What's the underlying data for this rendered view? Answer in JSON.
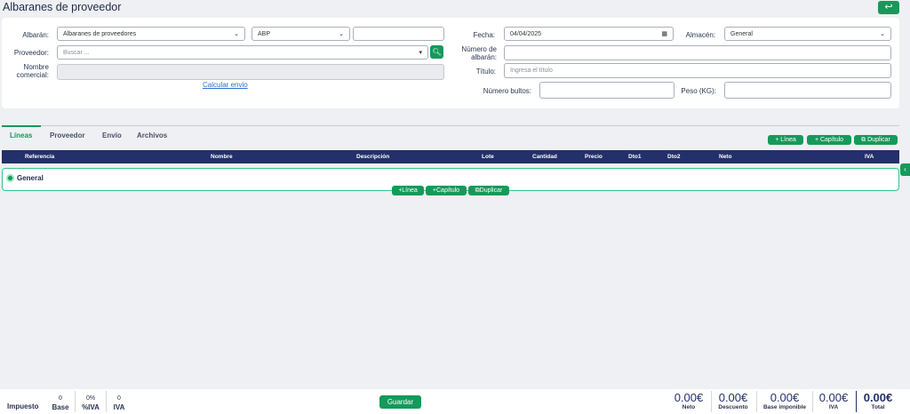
{
  "header": {
    "title": "Albaranes de proveedor",
    "back_icon": "↩"
  },
  "form": {
    "albaran_label": "Albarán:",
    "albaran_type": "Albaranes de proveedores",
    "serie": "ABP",
    "proveedor_label": "Proveedor:",
    "proveedor_placeholder": "Buscar ...",
    "nombre_label_1": "Nombre",
    "nombre_label_2": "comercial:",
    "calcular_link": "Calcular envio",
    "fecha_label": "Fecha:",
    "fecha_value": "04/04/2025",
    "almacen_label": "Almacén:",
    "almacen_value": "General",
    "numero_label_1": "Número de",
    "numero_label_2": "albarán:",
    "titulo_label": "Título:",
    "titulo_placeholder": "Ingresa el título",
    "bultos_label": "Número bultos:",
    "peso_label": "Peso (KG):"
  },
  "tabs": [
    "Líneas",
    "Proveedor",
    "Envío",
    "Archivos"
  ],
  "actions": {
    "linea": "Línea",
    "capitulo": "Capítulo",
    "duplicar": "Duplicar"
  },
  "table": {
    "headers": [
      "Referencia",
      "Nombre",
      "Descripción",
      "Lote",
      "Cantidad",
      "Precio",
      "Dto1",
      "Dto2",
      "Neto",
      "IVA"
    ]
  },
  "group": {
    "label": "General"
  },
  "footer": {
    "impuesto": "Impuesto",
    "base_value": "0",
    "base_label": "Base",
    "piva_value": "0%",
    "piva_label": "%IVA",
    "iva_value": "0",
    "iva_label": "IVA",
    "save": "Guardar",
    "totals": [
      {
        "value": "0.00€",
        "label": "Neto"
      },
      {
        "value": "0.00€",
        "label": "Descuento"
      },
      {
        "value": "0.00€",
        "label": "Base imponible"
      },
      {
        "value": "0.00€",
        "label": "IVA"
      },
      {
        "value": "0.00€",
        "label": "Total"
      }
    ]
  },
  "colors": {
    "accent": "#159a5a",
    "header": "#23306b"
  }
}
